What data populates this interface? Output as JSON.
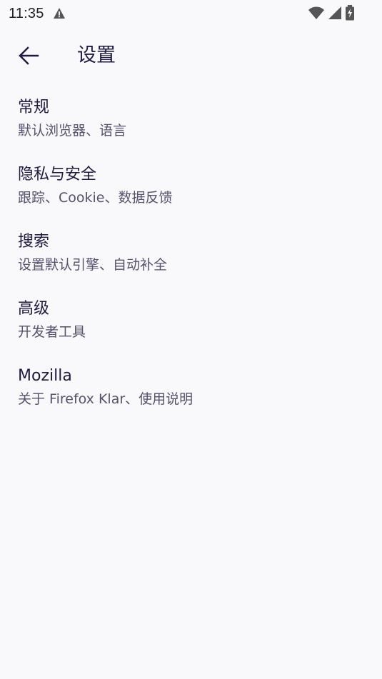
{
  "status_bar": {
    "time": "11:35",
    "icons": [
      "warning-icon",
      "wifi-icon",
      "cellular-signal-icon",
      "battery-charging-icon"
    ]
  },
  "toolbar": {
    "back_icon": "arrow-back-icon",
    "title": "设置"
  },
  "settings": {
    "items": [
      {
        "title": "常规",
        "summary": "默认浏览器、语言"
      },
      {
        "title": "隐私与安全",
        "summary": "跟踪、Cookie、数据反馈"
      },
      {
        "title": "搜索",
        "summary": "设置默认引擎、自动补全"
      },
      {
        "title": "高级",
        "summary": "开发者工具"
      },
      {
        "title": "Mozilla",
        "summary": "关于 Firefox Klar、使用说明"
      }
    ]
  },
  "colors": {
    "background": "#f9f9fc",
    "title_text": "#1f1a44",
    "summary_text": "#55516e",
    "status_icons": "#555555"
  }
}
